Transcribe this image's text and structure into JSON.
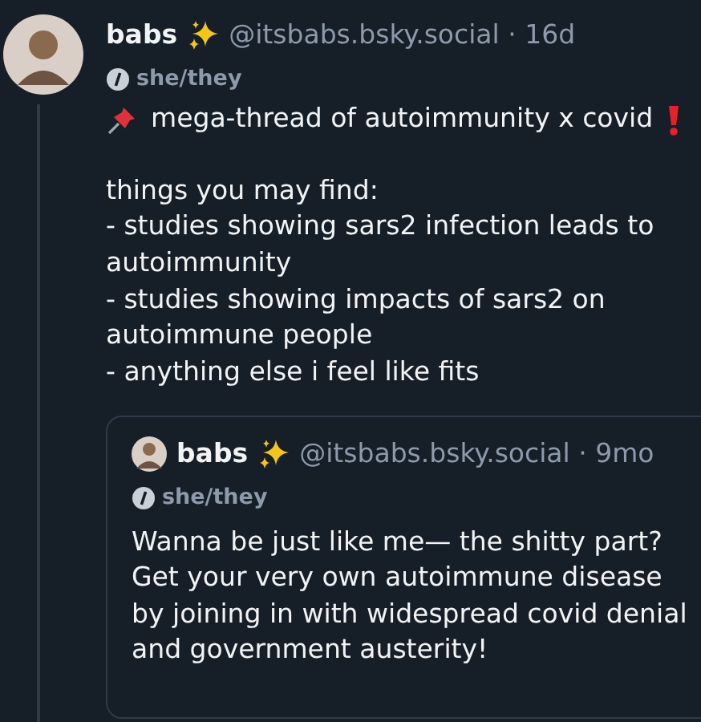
{
  "post": {
    "author": "babs",
    "handle": "@itsbabs.bsky.social",
    "time": "· 16d",
    "pronouns": "she/they",
    "title": "mega-thread of autoimmunity x covid",
    "lines": [
      "things you may find:",
      "- studies showing sars2 infection leads to",
      "autoimmunity",
      "- studies showing impacts of sars2 on",
      "autoimmune people",
      "- anything else i feel like fits"
    ]
  },
  "quote": {
    "author": "babs",
    "handle": "@itsbabs.bsky.social",
    "time": "· 9mo",
    "pronouns": "she/they",
    "lines": [
      "Wanna be just like me— the shitty part?",
      "Get your very own autoimmune disease",
      "by joining in with widespread covid denial",
      "and government austerity!"
    ]
  }
}
